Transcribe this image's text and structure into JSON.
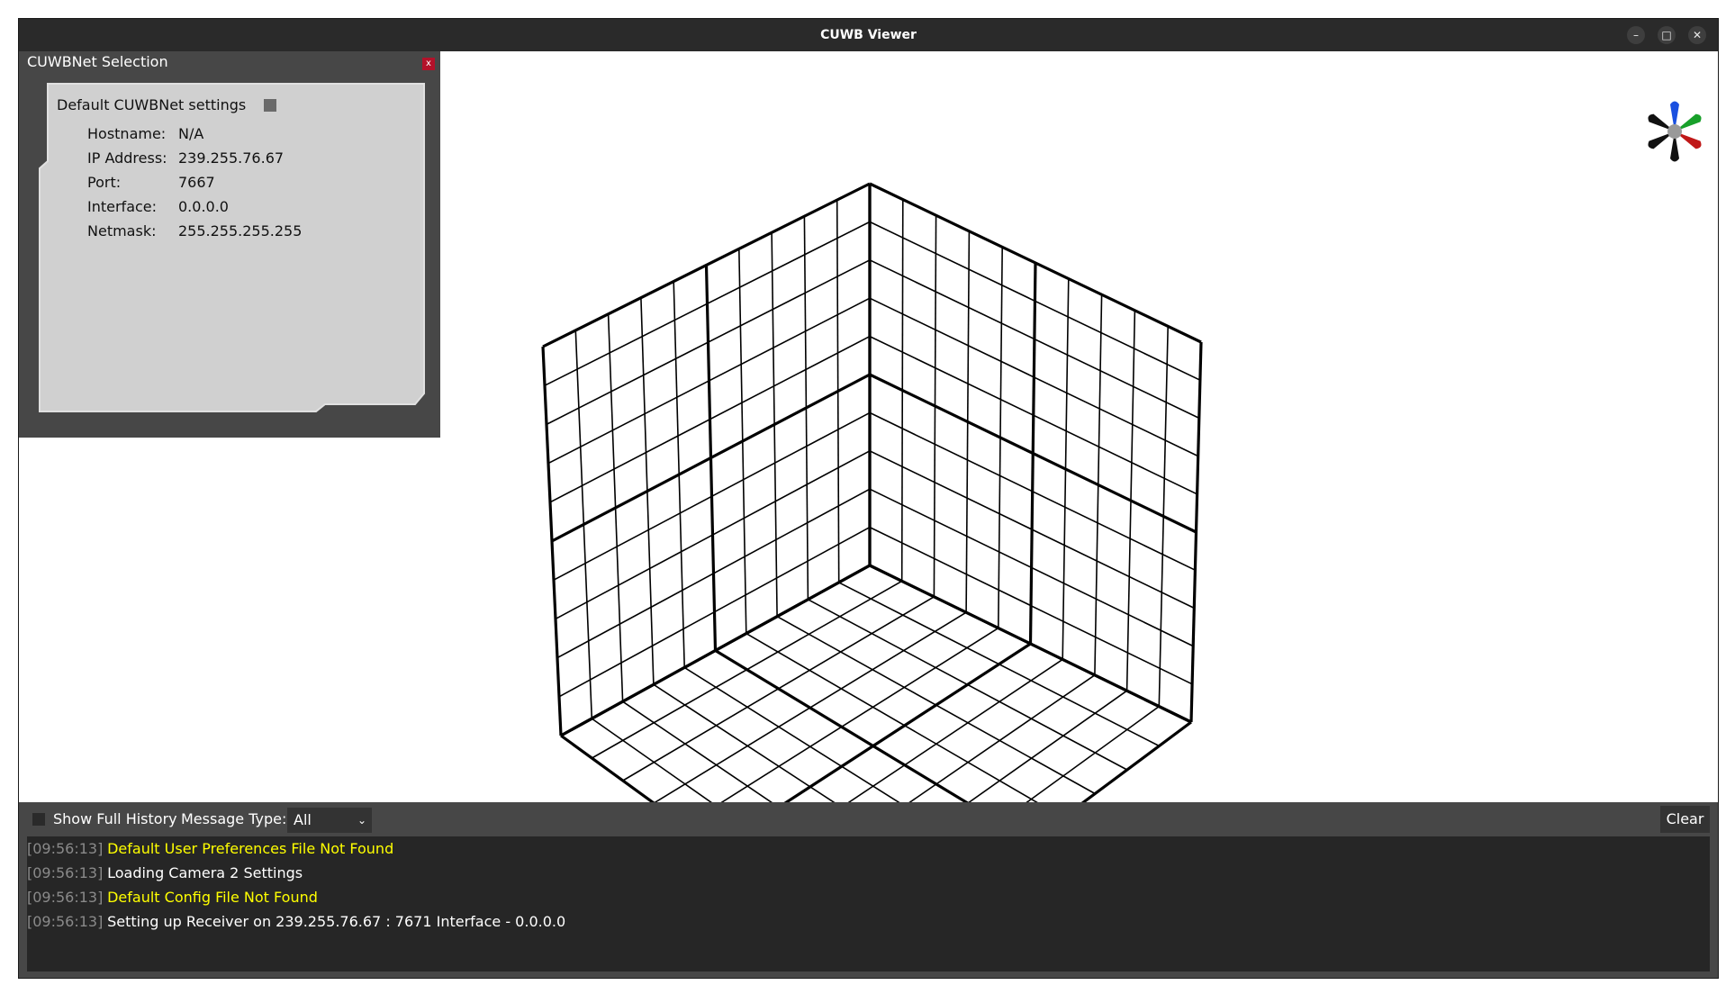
{
  "window": {
    "title": "CUWB Viewer",
    "controls": {
      "minimize": "–",
      "maximize": "□",
      "close": "✕"
    }
  },
  "cuwbnet_panel": {
    "title": "CUWBNet Selection",
    "close_label": "x",
    "default_settings_label": "Default CUWBNet settings",
    "fields": [
      {
        "key": "Hostname:",
        "value": "N/A"
      },
      {
        "key": "IP Address:",
        "value": "239.255.76.67"
      },
      {
        "key": "Port:",
        "value": "7667"
      },
      {
        "key": "Interface:",
        "value": "0.0.0.0"
      },
      {
        "key": "Netmask:",
        "value": "255.255.255.255"
      }
    ]
  },
  "axis_gizmo": {
    "icon": "axis-orientation-icon",
    "colors": {
      "up": "#1a50e0",
      "right_up": "#18a02a",
      "right_down": "#c01818",
      "left": "#111111",
      "center": "#999999"
    }
  },
  "console": {
    "show_full_history_label": "Show Full History",
    "message_type_label": "Message Type:",
    "message_type_value": "All",
    "clear_label": "Clear",
    "messages": [
      {
        "time": "[09:56:13]",
        "text": "Default User Preferences File Not Found",
        "level": "warning"
      },
      {
        "time": "[09:56:13]",
        "text": "Loading Camera 2 Settings",
        "level": "info"
      },
      {
        "time": "[09:56:13]",
        "text": "Default Config File Not Found",
        "level": "warning"
      },
      {
        "time": "[09:56:13]",
        "text": "Setting up Receiver on 239.255.76.67 : 7671 Interface - 0.0.0.0",
        "level": "info"
      }
    ],
    "colors": {
      "warning": "#ffff00",
      "info": "#ffffff",
      "timestamp": "#8a8a8a"
    }
  },
  "grid": {
    "cells_per_side": 10,
    "major_every": 5,
    "line_color": "#000000"
  }
}
